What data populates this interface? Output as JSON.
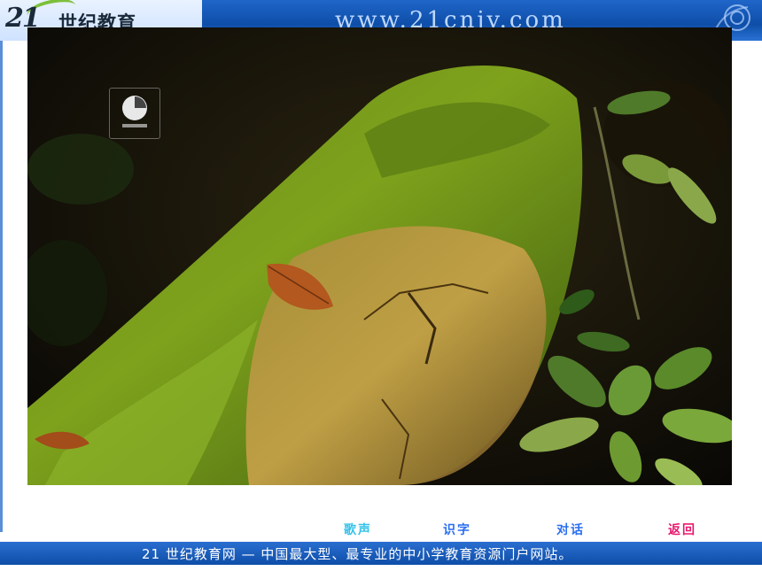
{
  "header": {
    "logo_number": "21",
    "logo_text": "世纪教育",
    "url": "www.21cnjy.com"
  },
  "nav": {
    "song_label": "歌声",
    "read_label": "识字",
    "talk_label": "对话",
    "back_label": "返回"
  },
  "footer": {
    "slogan": "21 世纪教育网 — 中国最大型、最专业的中小学教育资源门户网站。"
  },
  "colors": {
    "header_blue": "#0e4ea8",
    "link_cyan": "#36c2e8",
    "link_blue": "#2a6ef0",
    "link_pink": "#e8196e"
  }
}
